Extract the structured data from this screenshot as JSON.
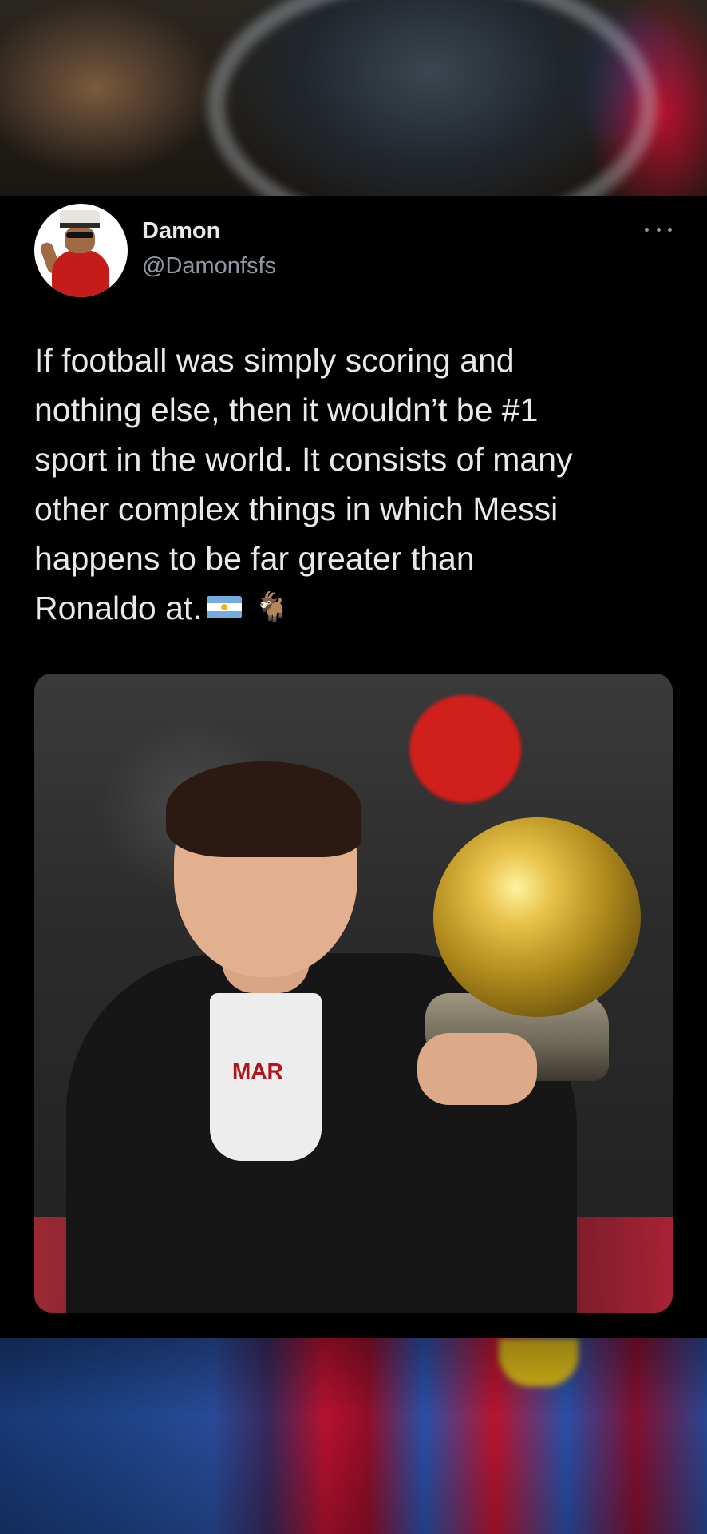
{
  "tweet": {
    "display_name": "Damon",
    "handle": "@Damonfsfs",
    "text": "If football was simply scoring and\nnothing else, then it wouldn’t be #1\nsport in the world. It consists of many\nother complex things in which Messi\nhappens to be far greater than\nRonaldo at.",
    "emoji": [
      "argentina-flag-icon",
      "goat-emoji-icon"
    ],
    "goat_glyph": "🐐"
  },
  "photo": {
    "shirt_print": "MAR"
  },
  "colors": {
    "background": "#000000",
    "text_primary": "#e7e9ea",
    "text_secondary": "#8b98a5"
  }
}
